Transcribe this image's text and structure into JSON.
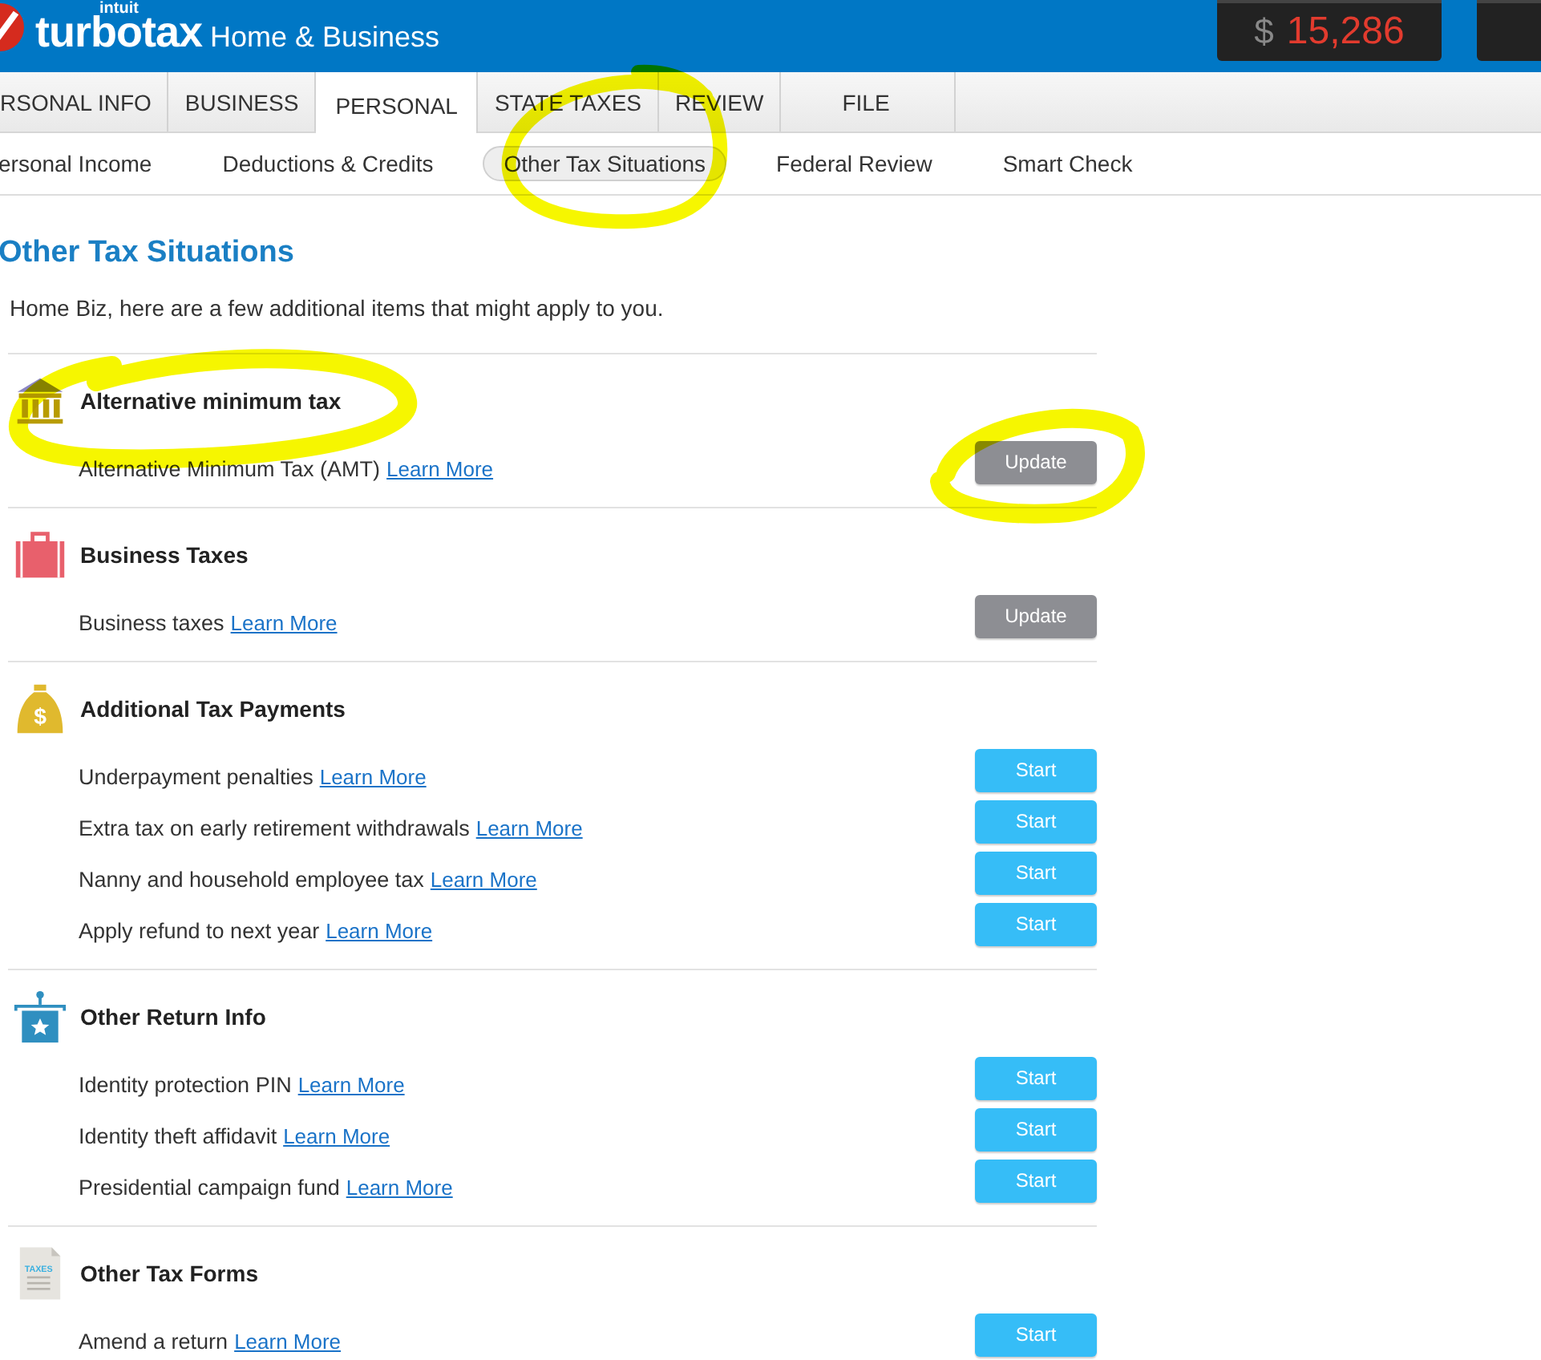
{
  "header": {
    "brand_small": "intuit",
    "brand": "turbotax",
    "product": "Home & Business",
    "refund": {
      "currency": "$",
      "amount": "15,286"
    }
  },
  "tabs": [
    {
      "label": "RSONAL INFO",
      "selected": false
    },
    {
      "label": "BUSINESS",
      "selected": false
    },
    {
      "label": "PERSONAL",
      "selected": true
    },
    {
      "label": "STATE TAXES",
      "selected": false
    },
    {
      "label": "REVIEW",
      "selected": false
    },
    {
      "label": "FILE",
      "selected": false
    }
  ],
  "subnav": [
    {
      "label": "ersonal Income",
      "selected": false
    },
    {
      "label": "Deductions & Credits",
      "selected": false
    },
    {
      "label": "Other Tax Situations",
      "selected": true
    },
    {
      "label": "Federal Review",
      "selected": false
    },
    {
      "label": "Smart Check",
      "selected": false
    }
  ],
  "page": {
    "title": "Other Tax Situations",
    "intro": "Home Biz, here are a few additional items that might apply to you."
  },
  "sections": [
    {
      "title": "Alternative minimum tax",
      "items": [
        {
          "label": "Alternative Minimum Tax (AMT)",
          "link": "Learn More",
          "button": "Update",
          "kind": "update"
        }
      ]
    },
    {
      "title": "Business Taxes",
      "items": [
        {
          "label": "Business taxes",
          "link": "Learn More",
          "button": "Update",
          "kind": "update"
        }
      ]
    },
    {
      "icon_text": "$",
      "title": "Additional Tax Payments",
      "items": [
        {
          "label": "Underpayment penalties",
          "link": "Learn More",
          "button": "Start",
          "kind": "start"
        },
        {
          "label": "Extra tax on early retirement withdrawals",
          "link": "Learn More",
          "button": "Start",
          "kind": "start"
        },
        {
          "label": "Nanny and household employee tax",
          "link": "Learn More",
          "button": "Start",
          "kind": "start"
        },
        {
          "label": "Apply refund to next year",
          "link": "Learn More",
          "button": "Start",
          "kind": "start"
        }
      ]
    },
    {
      "title": "Other Return Info",
      "items": [
        {
          "label": "Identity protection PIN",
          "link": "Learn More",
          "button": "Start",
          "kind": "start"
        },
        {
          "label": "Identity theft affidavit",
          "link": "Learn More",
          "button": "Start",
          "kind": "start"
        },
        {
          "label": "Presidential campaign fund",
          "link": "Learn More",
          "button": "Start",
          "kind": "start"
        }
      ]
    },
    {
      "icon_text": "TAXES",
      "title": "Other Tax Forms",
      "items": [
        {
          "label": "Amend a return",
          "link": "Learn More",
          "button": "Start",
          "kind": "start"
        }
      ]
    }
  ]
}
